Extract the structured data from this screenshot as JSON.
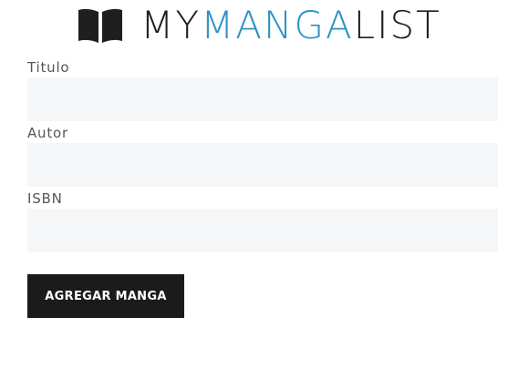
{
  "brand": {
    "part1": "MY",
    "part2": "MANGA",
    "part3": "LIST",
    "accent_color": "#2d93c4",
    "icon": "open-book-icon"
  },
  "form": {
    "fields": [
      {
        "label": "Titulo",
        "value": ""
      },
      {
        "label": "Autor",
        "value": ""
      },
      {
        "label": "ISBN",
        "value": ""
      }
    ],
    "submit_label": "AGREGAR MANGA"
  }
}
